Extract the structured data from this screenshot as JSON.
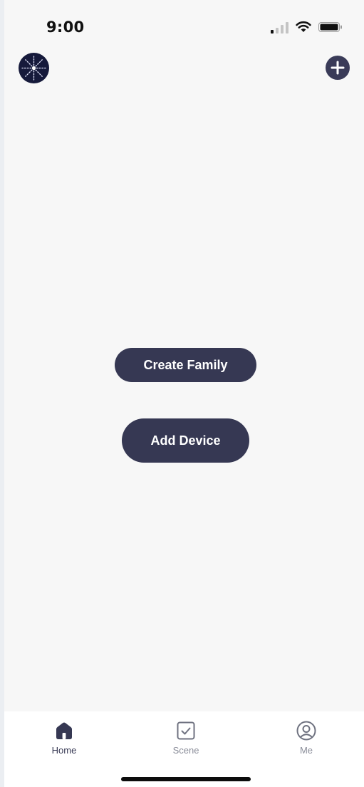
{
  "status_bar": {
    "time": "9:00",
    "signal_icon": "cellular-signal-icon",
    "wifi_icon": "wifi-icon",
    "battery_icon": "battery-icon"
  },
  "header": {
    "avatar_icon": "family-avatar-icon",
    "add_icon": "plus-circle-icon"
  },
  "main": {
    "create_family_label": "Create Family",
    "add_device_label": "Add Device"
  },
  "tab_bar": {
    "tabs": [
      {
        "label": "Home",
        "icon": "home-icon",
        "active": true
      },
      {
        "label": "Scene",
        "icon": "scene-checkbox-icon",
        "active": false
      },
      {
        "label": "Me",
        "icon": "user-circle-icon",
        "active": false
      }
    ]
  },
  "colors": {
    "background": "#f7f7f7",
    "accent": "#363853",
    "inactive_tab": "#8a8d99",
    "tab_bar": "#ffffff"
  }
}
